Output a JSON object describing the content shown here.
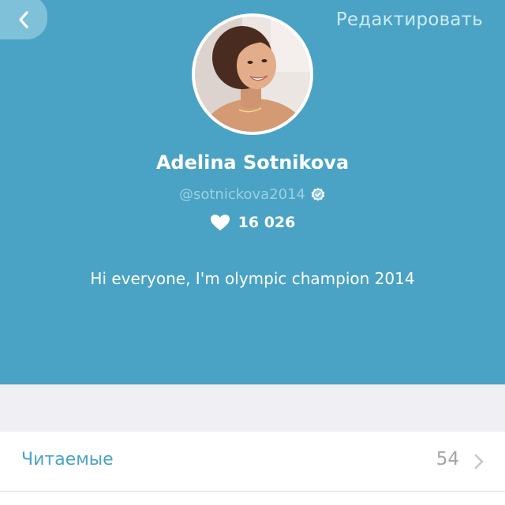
{
  "nav": {
    "back_icon": "chevron-left-icon",
    "edit_label": "Редактировать"
  },
  "profile": {
    "name": "Adelina Sotnikova",
    "handle": "@sotnickova2014",
    "verified_icon": "verified-check-icon",
    "likes_icon": "heart-icon",
    "likes": "16 026",
    "bio": "Hi everyone, I'm olympic champion 2014"
  },
  "list": {
    "items": [
      {
        "label": "Читаемые",
        "count": "54",
        "icon": "chevron-right-icon"
      }
    ]
  },
  "colors": {
    "header_bg": "#4aa3c4",
    "accent": "#4aa3c4",
    "page_bg": "#efeff4"
  }
}
